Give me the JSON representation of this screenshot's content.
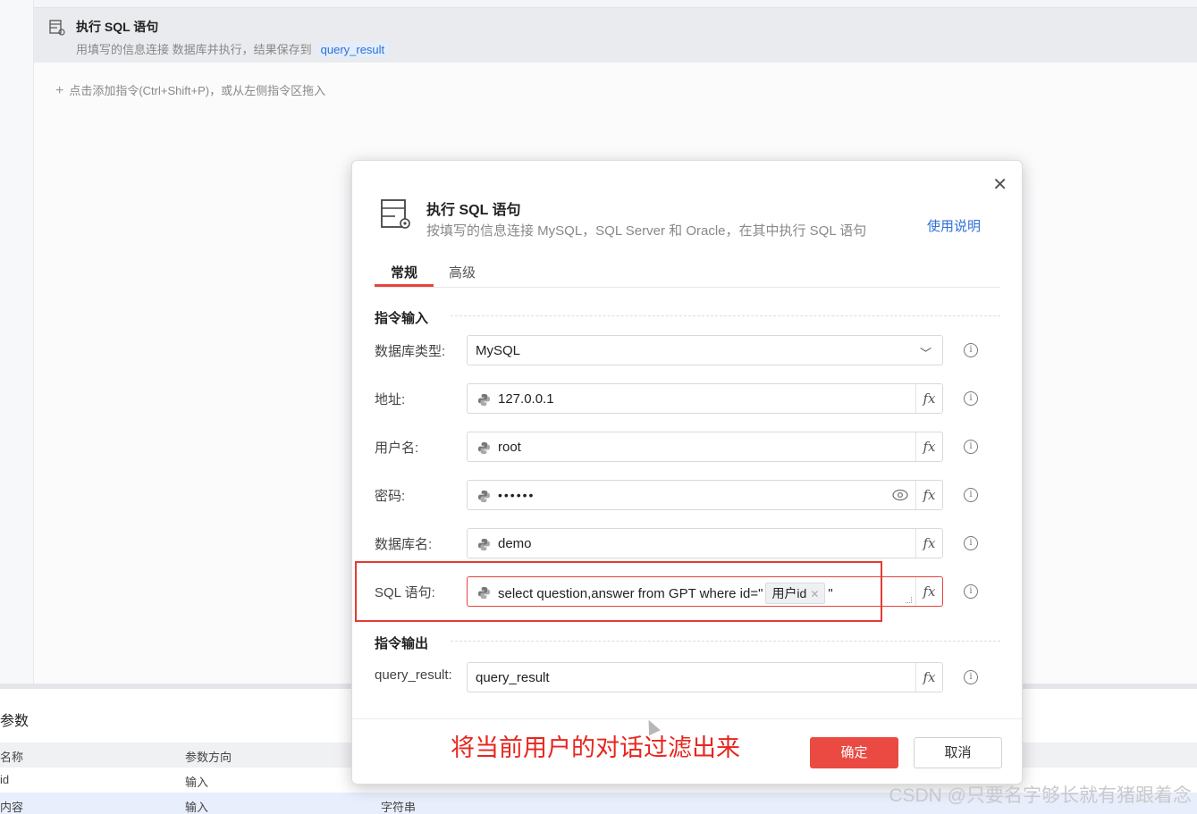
{
  "background": {
    "command_card": {
      "title": "执行 SQL 语句",
      "desc": "用填写的信息连接 数据库并执行，结果保存到",
      "result_tag": "query_result"
    },
    "add_hint": "点击添加指令(Ctrl+Shift+P)，或从左侧指令区拖入",
    "params": {
      "title": "参数",
      "headers": [
        "名称",
        "参数方向"
      ],
      "rows": [
        {
          "name": "id",
          "direction": "输入",
          "type": ""
        },
        {
          "name": "内容",
          "direction": "输入",
          "type": "字符串"
        }
      ]
    }
  },
  "dialog": {
    "title": "执行 SQL 语句",
    "desc": "按填写的信息连接 MySQL，SQL Server 和 Oracle，在其中执行 SQL 语句",
    "help_link": "使用说明",
    "tabs": [
      "常规",
      "高级"
    ],
    "section_input": "指令输入",
    "section_output": "指令输出",
    "fields": {
      "db_type": {
        "label": "数据库类型:",
        "value": "MySQL"
      },
      "host": {
        "label": "地址:",
        "value": "127.0.0.1"
      },
      "user": {
        "label": "用户名:",
        "value": "root"
      },
      "password": {
        "label": "密码:",
        "value": "••••••"
      },
      "db_name": {
        "label": "数据库名:",
        "value": "demo"
      },
      "sql": {
        "label": "SQL 语句:",
        "prefix": "select question,answer from GPT where id=\"",
        "variable": "用户id",
        "suffix": "\""
      },
      "output": {
        "label": "query_result:",
        "value": "query_result"
      }
    },
    "fx_label": "fx",
    "annotation": "将当前用户的对话过滤出来",
    "ok_button": "确定",
    "cancel_button": "取消"
  },
  "watermark": "CSDN @只要名字够长就有猪跟着念",
  "colors": {
    "accent_red": "#ea4a42",
    "link_blue": "#2f6fd6"
  }
}
